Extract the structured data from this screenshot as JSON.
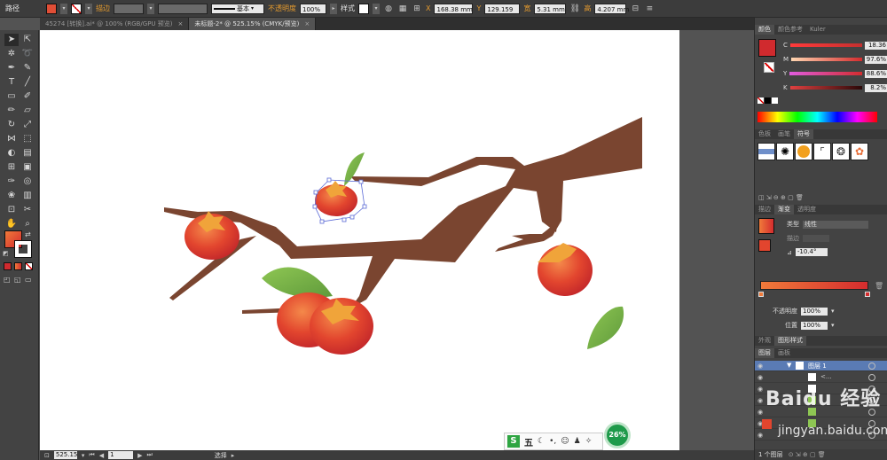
{
  "control_bar": {
    "tool_label": "路径",
    "stroke_label": "描边",
    "stroke_style": "基本",
    "opacity_label": "不透明度",
    "opacity_value": "100%",
    "style_label": "样式",
    "x_label": "X",
    "x_value": "168.38 mm",
    "y_label": "Y",
    "y_value": "129.159",
    "w_label": "宽",
    "w_value": "5.31 mm",
    "h_label": "高",
    "h_value": "4.207 mm"
  },
  "tabs": [
    {
      "label": "45274 [转换].ai* @ 100% (RGB/GPU 预览)",
      "active": false
    },
    {
      "label": "未标题-2* @ 525.15% (CMYK/预览)",
      "active": true
    }
  ],
  "status_bar": {
    "zoom": "525.15",
    "page": "1",
    "mode": "选择"
  },
  "color_panel": {
    "tabs": [
      "颜色",
      "颜色参考",
      "Kuler"
    ],
    "channels": [
      {
        "label": "C",
        "value": "18.36"
      },
      {
        "label": "M",
        "value": "97.6%"
      },
      {
        "label": "Y",
        "value": "88.6%"
      },
      {
        "label": "K",
        "value": "8.2%"
      }
    ],
    "fill_color": "#d02a2e"
  },
  "symbols_panel": {
    "tabs": [
      "色板",
      "画笔",
      "符号"
    ]
  },
  "gradient_panel": {
    "tabs": [
      "描边",
      "渐变",
      "透明度"
    ],
    "type_label": "类型",
    "type_value": "线性",
    "stroke_label": "描边",
    "angle_value": "-10.4°",
    "opacity_label": "不透明度",
    "opacity_value": "100%",
    "location_label": "位置",
    "location_value": "100%",
    "gradient_start": "#f07a3a",
    "gradient_end": "#d42c2e"
  },
  "layers_panel": {
    "top_tabs": [
      "外观",
      "图形样式"
    ],
    "tabs": [
      "图层",
      "画板"
    ],
    "layer_name": "图层 1",
    "sublayer_label": "<...",
    "footer": "1 个图层"
  },
  "overlays": {
    "ime_label": "五",
    "progress_badge": "26%",
    "watermark": "Baidu 经验",
    "watermark_url": "jingyan.baidu.com"
  }
}
